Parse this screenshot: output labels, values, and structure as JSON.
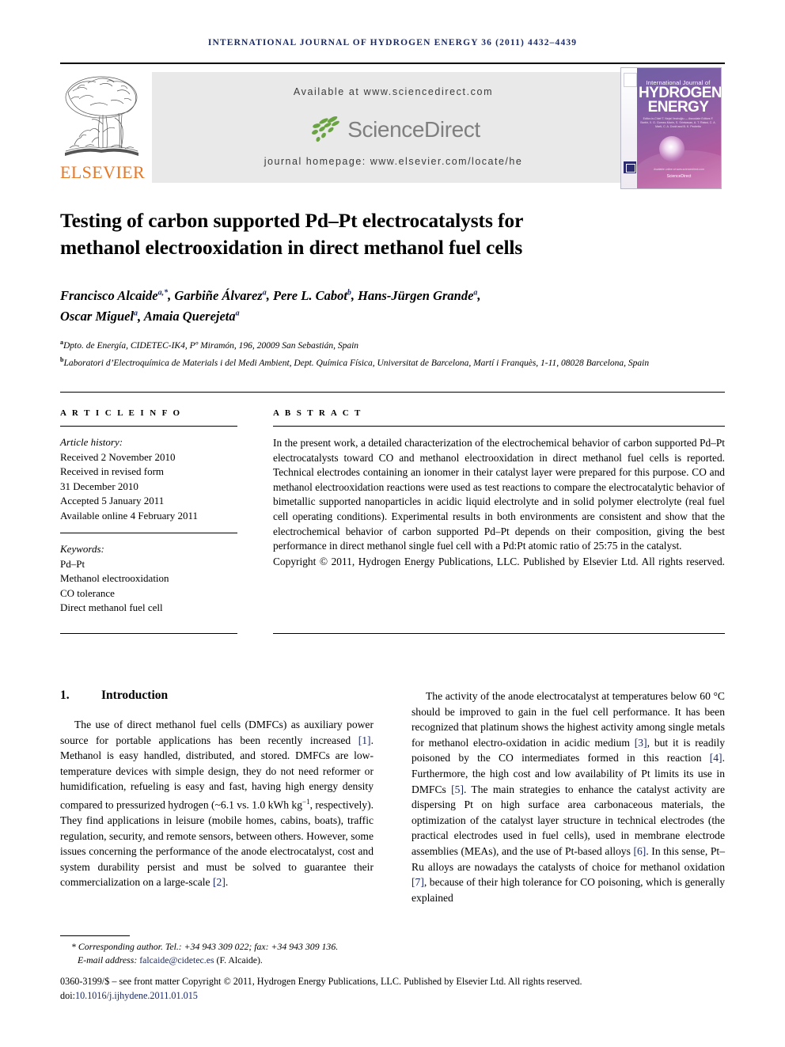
{
  "running_head": "International Journal of Hydrogen Energy 36 (2011) 4432–4439",
  "masthead": {
    "publisher": "ELSEVIER",
    "available_at": "Available at www.sciencedirect.com",
    "sciencedirect_wordmark": "ScienceDirect",
    "journal_homepage": "journal homepage: www.elsevier.com/locate/he",
    "cover": {
      "line1": "International Journal of",
      "line2": "HYDROGEN",
      "line3": "ENERGY",
      "editors": "Editor-in-Chief  T. Nejat Veziroğlu — Associate Editors  F. Barbir, X. G. Gomez-Marín, S. Srinivasan, A. T. Raissi, C. A. Marti, C. A. Dodd and B. K. Pedretto",
      "sciencedirect_badge": "ScienceDirect",
      "sciencedirect_badge_sub": "Available online at www.sciencedirect.com"
    }
  },
  "article": {
    "title_line1": "Testing of carbon supported Pd–Pt electrocatalysts for",
    "title_line2": "methanol electrooxidation in direct methanol fuel cells",
    "authors_line1_parts": [
      {
        "name": "Francisco Alcaide",
        "sup": "a,*"
      },
      {
        "name": "Garbiñe Álvarez",
        "sup": "a"
      },
      {
        "name": "Pere L. Cabot",
        "sup": "b"
      },
      {
        "name": "Hans-Jürgen Grande",
        "sup": "a"
      }
    ],
    "authors_line2_parts": [
      {
        "name": "Oscar Miguel",
        "sup": "a"
      },
      {
        "name": "Amaia Querejeta",
        "sup": "a"
      }
    ],
    "affiliations": [
      {
        "mark": "a",
        "text": "Dpto. de Energía, CIDETEC-IK4, Pº Miramón, 196, 20009 San Sebastián, Spain"
      },
      {
        "mark": "b",
        "text": "Laboratori d’Electroquímica de Materials i del Medi Ambient, Dept. Química Física, Universitat de Barcelona, Martí i Franquès, 1-11, 08028 Barcelona, Spain"
      }
    ]
  },
  "article_info": {
    "heading": "A R T I C L E   I N F O",
    "history_label": "Article history:",
    "history": [
      "Received 2 November 2010",
      "Received in revised form",
      "31 December 2010",
      "Accepted 5 January 2011",
      "Available online 4 February 2011"
    ],
    "keywords_label": "Keywords:",
    "keywords": [
      "Pd–Pt",
      "Methanol electrooxidation",
      "CO tolerance",
      "Direct methanol fuel cell"
    ]
  },
  "abstract": {
    "heading": "A B S T R A C T",
    "body": "In the present work, a detailed characterization of the electrochemical behavior of carbon supported Pd–Pt electrocatalysts toward CO and methanol electrooxidation in direct methanol fuel cells is reported. Technical electrodes containing an ionomer in their catalyst layer were prepared for this purpose. CO and methanol electrooxidation reactions were used as test reactions to compare the electrocatalytic behavior of bimetallic supported nanoparticles in acidic liquid electrolyte and in solid polymer electrolyte (real fuel cell operating conditions). Experimental results in both environments are consistent and show that the electrochemical behavior of carbon supported Pd–Pt depends on their composition, giving the best performance in direct methanol single fuel cell with a Pd:Pt atomic ratio of 25:75 in the catalyst.",
    "copyright": "Copyright © 2011, Hydrogen Energy Publications, LLC. Published by Elsevier Ltd. All rights reserved."
  },
  "body": {
    "section_number": "1.",
    "section_title": "Introduction",
    "left_paragraph_pre": "The use of direct methanol fuel cells (DMFCs) as auxiliary power source for portable applications has been recently increased ",
    "left_ref_1": "[1]",
    "left_paragraph_mid": ". Methanol is easy handled, distributed, and stored. DMFCs are low-temperature devices with simple design, they do not need reformer or humidification, refueling is easy and fast, having high energy density compared to pressurized hydrogen (~6.1 vs. 1.0 kWh kg",
    "left_sup": "−1",
    "left_paragraph_mid2": ", respectively). They find applications in leisure (mobile homes, cabins, boats), traffic regulation, security, and remote sensors, between others. However, some issues concerning the performance of the anode electrocatalyst, cost and system durability persist and must be solved to guarantee their commercialization on a large-scale ",
    "left_ref_2": "[2]",
    "left_paragraph_end": ".",
    "right_p1": "The activity of the anode electrocatalyst at temperatures below 60 °C should be improved to gain in the fuel cell performance. It has been recognized that platinum shows the highest activity among single metals for methanol electro-oxidation in acidic medium ",
    "right_ref_3": "[3]",
    "right_p2": ", but it is readily poisoned by the CO intermediates formed in this reaction ",
    "right_ref_4": "[4]",
    "right_p3": ". Furthermore, the high cost and low availability of Pt limits its use in DMFCs ",
    "right_ref_5": "[5]",
    "right_p4": ". The main strategies to enhance the catalyst activity are dispersing Pt on high surface area carbonaceous materials, the optimization of the catalyst layer structure in technical electrodes (the practical electrodes used in fuel cells), used in membrane electrode assemblies (MEAs), and the use of Pt-based alloys ",
    "right_ref_6": "[6]",
    "right_p5": ". In this sense, Pt–Ru alloys are nowadays the catalysts of choice for methanol oxidation ",
    "right_ref_7": "[7]",
    "right_p6": ", because of their high tolerance for CO poisoning, which is generally explained"
  },
  "footer": {
    "corresponding_marker": "*",
    "corresponding": "Corresponding author. Tel.: +34 943 309 022; fax: +34 943 309 136.",
    "email_label": "E-mail address: ",
    "email": "falcaide@cidetec.es",
    "email_suffix": " (F. Alcaide).",
    "issn_line": "0360-3199/$ – see front matter Copyright © 2011, Hydrogen Energy Publications, LLC. Published by Elsevier Ltd. All rights reserved.",
    "doi_prefix": "doi:",
    "doi": "10.1016/j.ijhydene.2011.01.015"
  },
  "colors": {
    "header_blue": "#1b2a63",
    "elsevier_orange": "#e87722",
    "sciencedirect_green": "#6aa342",
    "banner_gray": "#e9e9e9"
  }
}
